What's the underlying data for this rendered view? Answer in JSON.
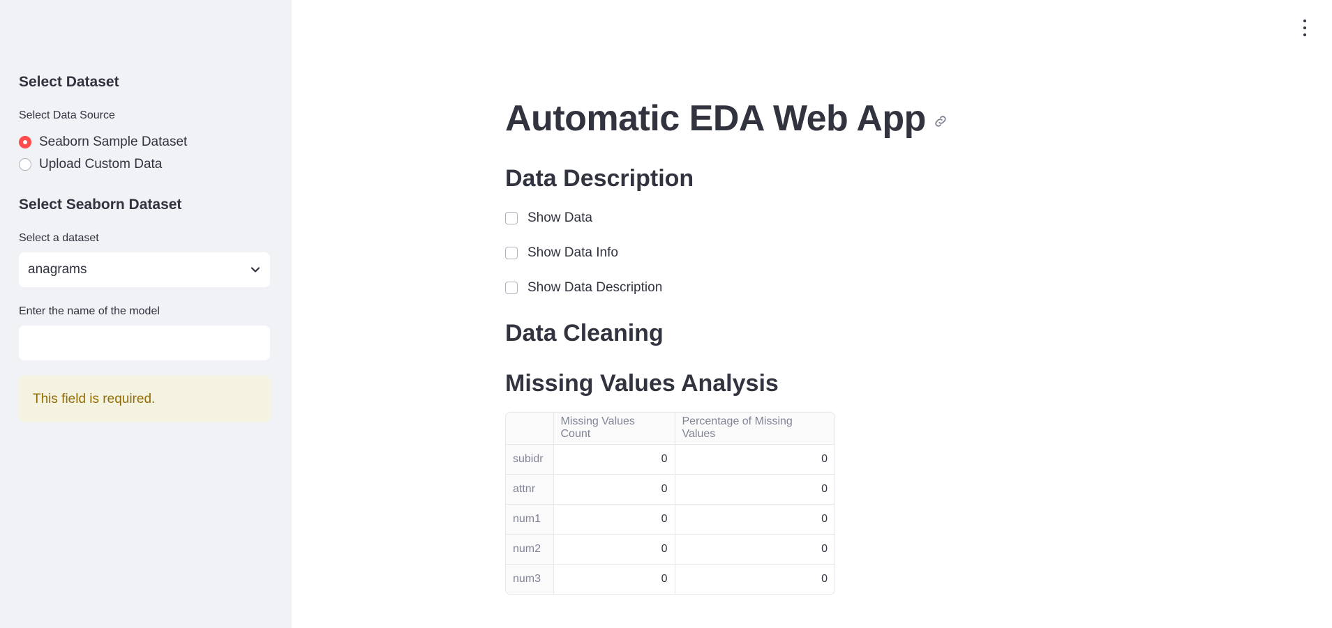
{
  "sidebar": {
    "select_dataset_heading": "Select Dataset",
    "data_source_label": "Select Data Source",
    "data_source_options": [
      "Seaborn Sample Dataset",
      "Upload Custom Data"
    ],
    "data_source_selected": "Seaborn Sample Dataset",
    "seaborn_heading": "Select Seaborn Dataset",
    "dataset_select_label": "Select a dataset",
    "dataset_selected": "anagrams",
    "model_name_label": "Enter the name of the model",
    "model_name_value": "",
    "warning_text": "This field is required."
  },
  "main": {
    "title": "Automatic EDA Web App",
    "data_description_heading": "Data Description",
    "checkboxes": [
      "Show Data",
      "Show Data Info",
      "Show Data Description"
    ],
    "data_cleaning_heading": "Data Cleaning",
    "missing_values_heading": "Missing Values Analysis",
    "table": {
      "columns": [
        "",
        "Missing Values Count",
        "Percentage of Missing Values"
      ],
      "rows": [
        [
          "subidr",
          "0",
          "0"
        ],
        [
          "attnr",
          "0",
          "0"
        ],
        [
          "num1",
          "0",
          "0"
        ],
        [
          "num2",
          "0",
          "0"
        ],
        [
          "num3",
          "0",
          "0"
        ]
      ]
    }
  },
  "colors": {
    "accent": "#ff4b4b",
    "sidebar_bg": "#f0f2f6",
    "warning_bg": "#f4f2e0",
    "warning_text": "#926c05"
  },
  "icons": {
    "menu": "vertical-dots-icon",
    "heading_anchor": "link-icon",
    "select_chevron": "chevron-down-icon"
  }
}
